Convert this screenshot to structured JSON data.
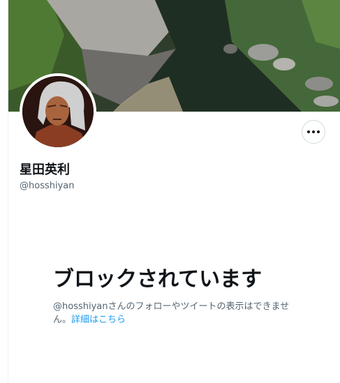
{
  "profile": {
    "display_name": "星田英利",
    "handle": "@hosshiyan"
  },
  "blocked": {
    "title": "ブロックされています",
    "description": "@hosshiyanさんのフォローやツイートの表示はできません。",
    "link_text": "詳細はこちら"
  },
  "icons": {
    "more": "more-horizontal-icon"
  },
  "colors": {
    "link": "#1d9bf0",
    "secondary_text": "#536471",
    "primary_text": "#0f1419",
    "border": "#cfd9de"
  }
}
